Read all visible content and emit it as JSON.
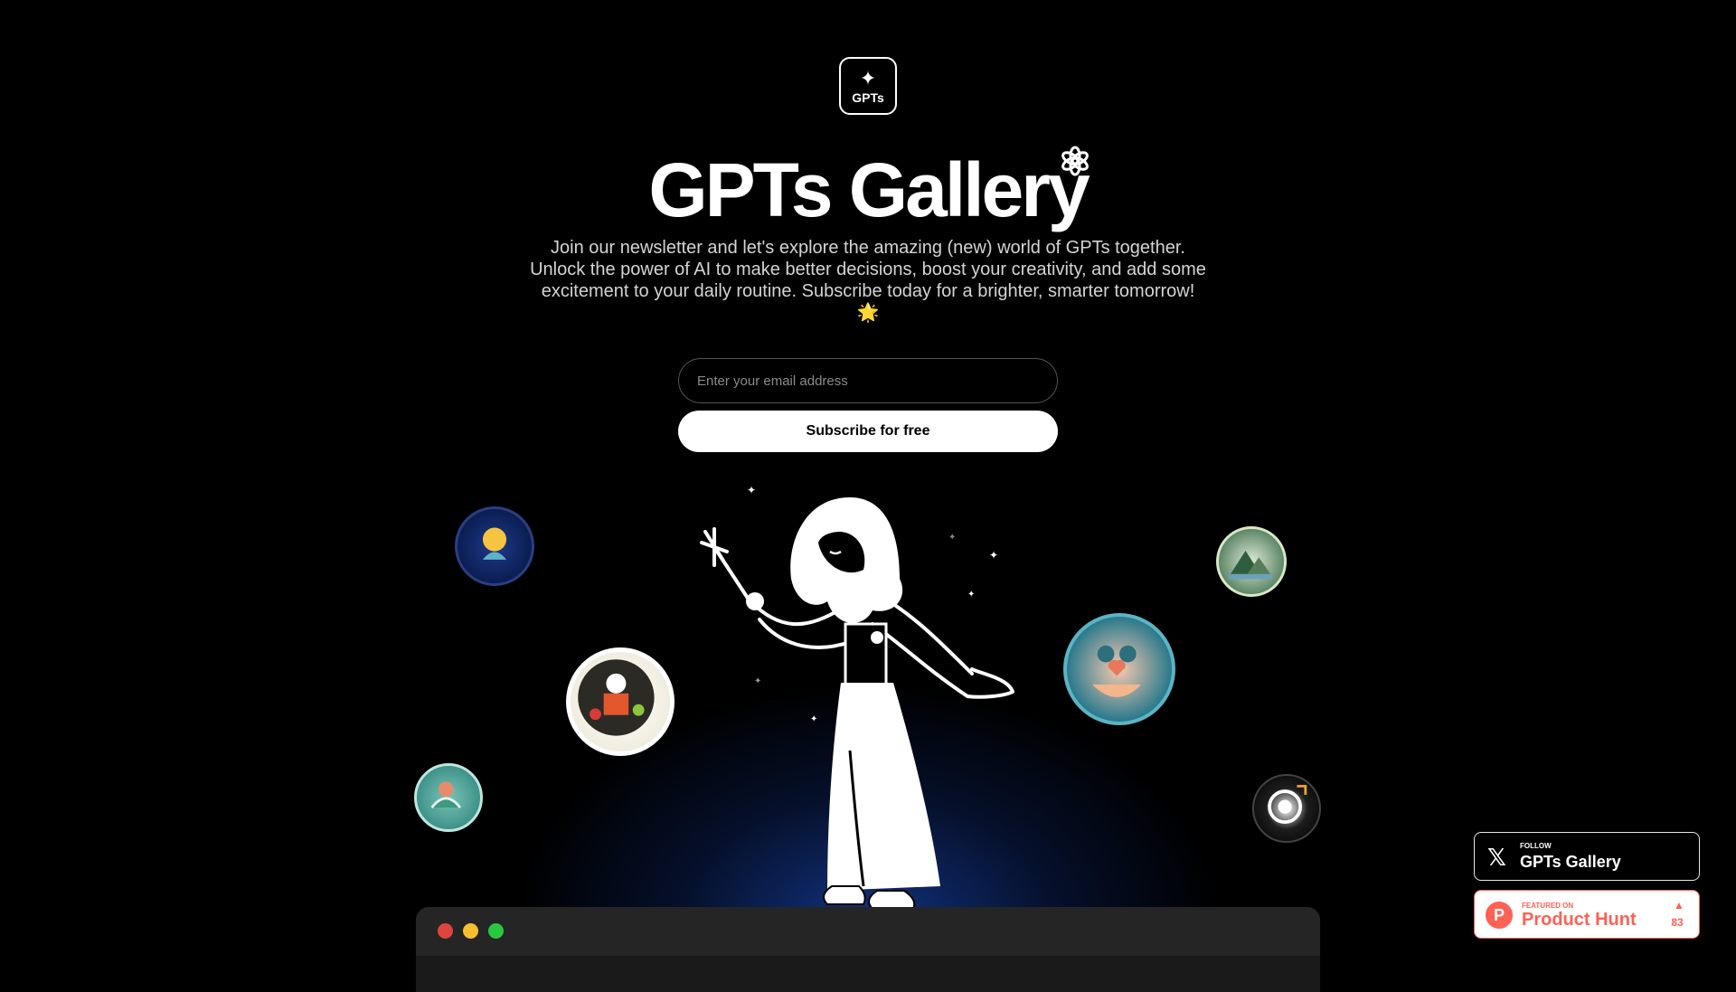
{
  "logo": {
    "icon": "sparkle-icon",
    "label": "GPTs"
  },
  "hero": {
    "title": "GPTs Gallery",
    "subtitle_line1": "Join our newsletter and let's explore the amazing (new) world of GPTs together.",
    "subtitle_line2": "Unlock the power of AI to make better decisions, boost your creativity, and add some",
    "subtitle_line3": "excitement to your daily routine. Subscribe today for a brighter, smarter tomorrow!",
    "subtitle_emoji": "🌟"
  },
  "form": {
    "email_placeholder": "Enter your email address",
    "subscribe_label": "Subscribe for free"
  },
  "badges": {
    "x": {
      "follow": "FOLLOW",
      "name": "GPTs Gallery"
    },
    "producthunt": {
      "featured": "FEATURED ON",
      "name": "Product Hunt",
      "count": "83"
    }
  },
  "colors": {
    "accent_glow": "#143c96",
    "window_dot_red": "#e0443e",
    "window_dot_yellow": "#f5bf2f",
    "window_dot_green": "#28c840",
    "producthunt": "#ff6154"
  }
}
